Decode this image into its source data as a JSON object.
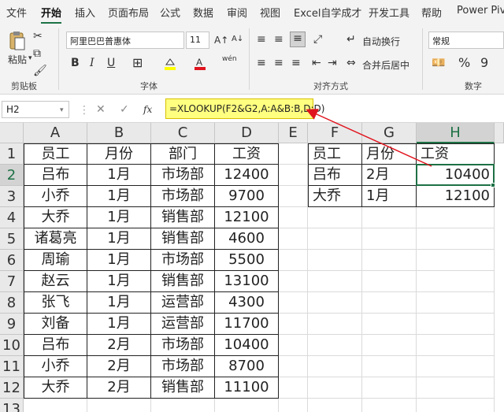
{
  "menu": {
    "tabs": [
      "文件",
      "开始",
      "插入",
      "页面布局",
      "公式",
      "数据",
      "审阅",
      "视图",
      "Excel自学成才",
      "开发工具",
      "帮助",
      "Power Pivot"
    ],
    "active": "开始"
  },
  "ribbon": {
    "paste_label": "粘贴",
    "clipboard_label": "剪贴板",
    "font_name": "阿里巴巴普惠体",
    "font_size": "11",
    "font_label": "字体",
    "wrap_label": "自动换行",
    "merge_label": "合并后居中",
    "align_label": "对齐方式",
    "number_format": "常规",
    "number_label": "数字",
    "bold": "B",
    "italic": "I",
    "underline": "U",
    "grow_font": "A↑",
    "shrink_font": "A↓",
    "phonetic": "wén",
    "percent": "%",
    "comma": "9"
  },
  "formula_bar": {
    "name_box": "H2",
    "formula": "=XLOOKUP(F2&G2,A:A&B:B,D:D)",
    "fx": "fx"
  },
  "sheet": {
    "columns": [
      "A",
      "B",
      "C",
      "D",
      "E",
      "F",
      "G",
      "H"
    ],
    "selected_col": "H",
    "rows": [
      "1",
      "2",
      "3",
      "4",
      "5",
      "6",
      "7",
      "8",
      "9",
      "10",
      "11",
      "12",
      "13"
    ],
    "selected_row": "2",
    "table1_header": [
      "员工",
      "月份",
      "部门",
      "工资"
    ],
    "table1_rows": [
      [
        "吕布",
        "1月",
        "市场部",
        "12400"
      ],
      [
        "小乔",
        "1月",
        "市场部",
        "9700"
      ],
      [
        "大乔",
        "1月",
        "销售部",
        "12100"
      ],
      [
        "诸葛亮",
        "1月",
        "销售部",
        "4600"
      ],
      [
        "周瑜",
        "1月",
        "市场部",
        "5500"
      ],
      [
        "赵云",
        "1月",
        "销售部",
        "13100"
      ],
      [
        "张飞",
        "1月",
        "运营部",
        "4300"
      ],
      [
        "刘备",
        "1月",
        "运营部",
        "11700"
      ],
      [
        "吕布",
        "2月",
        "市场部",
        "10400"
      ],
      [
        "小乔",
        "2月",
        "市场部",
        "8700"
      ],
      [
        "大乔",
        "2月",
        "销售部",
        "11100"
      ]
    ],
    "table2_header": [
      "员工",
      "月份",
      "工资"
    ],
    "table2_rows": [
      [
        "吕布",
        "2月",
        "10400"
      ],
      [
        "大乔",
        "1月",
        "12100"
      ]
    ]
  },
  "colors": {
    "accent": "#1e7145",
    "formula_highlight": "#ffff80",
    "arrow": "#e0141e"
  }
}
